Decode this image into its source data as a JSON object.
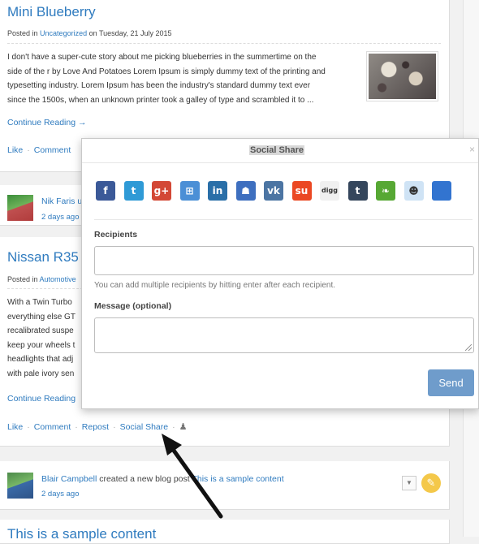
{
  "posts": [
    {
      "title": "Mini Blueberry",
      "posted_prefix": "Posted in",
      "category": "Uncategorized",
      "posted_suffix": "on Tuesday, 21 July 2015",
      "excerpt": [
        "I don't have a super-cute story about me picking blueberries in the summertime on the",
        "side of the r by Love And Potatoes Lorem Ipsum is simply dummy text of the printing and",
        "typesetting industry. Lorem Ipsum has been the industry's standard dummy text ever",
        "since the 1500s, when an unknown printer took a galley of type and scrambled it to ..."
      ],
      "continue": "Continue Reading →",
      "actions": [
        "Like",
        "Comment"
      ]
    },
    {
      "title": "Nissan R35 -",
      "posted_prefix": "Posted in",
      "category": "Automotive",
      "excerpt": [
        "With a Twin Turbo",
        "everything else GT",
        "recalibrated suspe",
        "keep your wheels t",
        "headlights that adj",
        "with pale ivory sen"
      ],
      "continue": "Continue Reading",
      "actions": [
        "Like",
        "Comment",
        "Repost",
        "Social Share"
      ]
    }
  ],
  "feed": [
    {
      "name": "Nik Faris u",
      "time": "2 days ago"
    },
    {
      "name": "Blair Campbell",
      "action": "created a new blog post",
      "link": "This is a sample content",
      "time": "2 days ago"
    }
  ],
  "bottom_title": "This is a sample content",
  "modal": {
    "title": "Social Share",
    "close": "×",
    "recipients_label": "Recipients",
    "recipients_value": "",
    "help": "You can add multiple recipients by hitting enter after each recipient.",
    "message_label": "Message (optional)",
    "message_value": "",
    "send": "Send",
    "share_icons": [
      {
        "name": "facebook-icon",
        "glyph": "f",
        "color": "#3b5998"
      },
      {
        "name": "twitter-icon",
        "glyph": "t",
        "color": "#2f9ad6"
      },
      {
        "name": "google-plus-icon",
        "glyph": "g+",
        "color": "#d34836"
      },
      {
        "name": "windows-live-icon",
        "glyph": "⊞",
        "color": "#4b8fd6"
      },
      {
        "name": "linkedin-icon",
        "glyph": "in",
        "color": "#2a6fa8"
      },
      {
        "name": "myspace-icon",
        "glyph": "☗",
        "color": "#3e6fbf"
      },
      {
        "name": "vk-icon",
        "glyph": "vk",
        "color": "#4c75a3"
      },
      {
        "name": "stumbleupon-icon",
        "glyph": "su",
        "color": "#eb4823"
      },
      {
        "name": "digg-icon",
        "glyph": "digg",
        "color": "#f0f0f0"
      },
      {
        "name": "tumblr-icon",
        "glyph": "t",
        "color": "#35465c"
      },
      {
        "name": "evernote-icon",
        "glyph": "❧",
        "color": "#57a834"
      },
      {
        "name": "reddit-icon",
        "glyph": "☻",
        "color": "#cfe3f5"
      },
      {
        "name": "delicious-icon",
        "glyph": "",
        "color": "#3274d0"
      }
    ]
  }
}
